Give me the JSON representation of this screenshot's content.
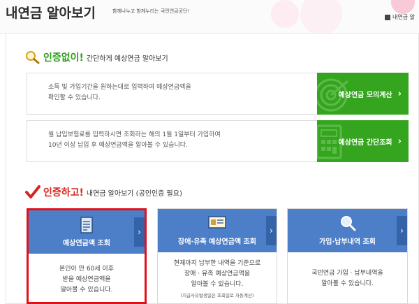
{
  "header": {
    "title": "내연금 알아보기",
    "tagline": "함께나누고 함께누리는 국민연금공단!",
    "go_link": "내연금 알"
  },
  "section1": {
    "highlight": "인증없이!",
    "subtitle": "간단하게 예상연금 알아보기",
    "rows": [
      {
        "desc_line1": "소득 및 가입기간을 원하는대로 입력하여 예상연금액을",
        "desc_line2": "확인할 수 있습니다.",
        "button": "예상연금 모의계산",
        "icon": "target-icon"
      },
      {
        "desc_line1": "월 납입보험료를 입력하시면 조회하는 해의 1월 1일부터 가입하여",
        "desc_line2": "10년 이상 납입 후 예상연금액을 알아볼 수 있습니다.",
        "button": "예상연금 간단조회",
        "icon": "calculator-icon"
      }
    ]
  },
  "section2": {
    "highlight": "인증하고!",
    "subtitle": "내연금 알아보기 (공인인증 필요)",
    "cards": [
      {
        "title": "예상연금액 조회",
        "lines": [
          "본인이 만 60세 이후",
          "받을 예상연금액을",
          "알아볼 수 있습니다."
        ],
        "note": "",
        "icon": "document-icon"
      },
      {
        "title": "장애·유족 예상연금액 조회",
        "lines": [
          "현재까지 납부한 내역을 기준으로",
          "장애 · 유족 예상연금액을",
          "알아볼 수 있습니다."
        ],
        "note": "(지급사유발생일은 조회일로 자동계산)",
        "icon": "id-card-icon"
      },
      {
        "title": "가입·납부내역 조회",
        "lines": [
          "국민연금 가입 · 납부내역을",
          "알아볼 수 있습니다."
        ],
        "note": "",
        "icon": "magnifier-icon"
      }
    ]
  },
  "colors": {
    "green": "#35a51f",
    "blue": "#4d7fc8",
    "red": "#e3101b"
  }
}
